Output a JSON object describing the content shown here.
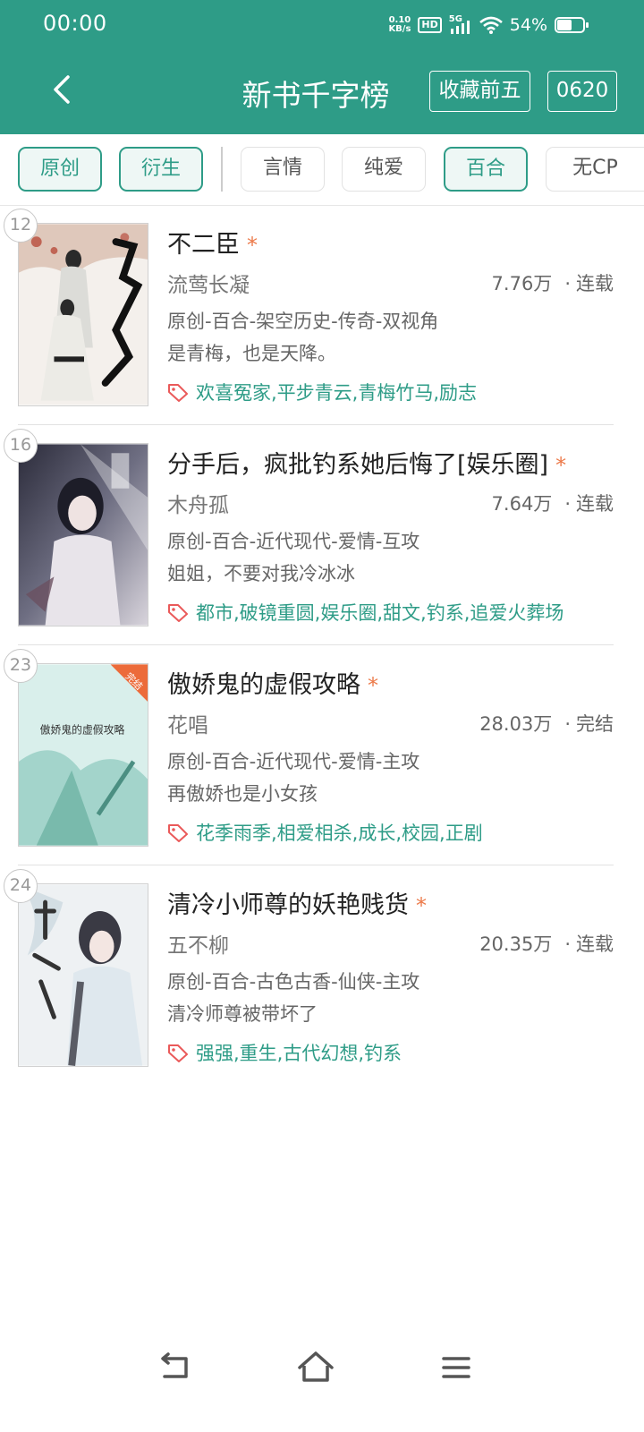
{
  "status_bar": {
    "time": "00:00",
    "net_speed_top": "0.10",
    "net_speed_unit": "KB/s",
    "hd": "HD",
    "network": "5G",
    "battery": "54%"
  },
  "header": {
    "title": "新书千字榜",
    "filter_button": "收藏前五",
    "date_button": "0620"
  },
  "chips": [
    "原创",
    "衍生",
    "言情",
    "纯爱",
    "百合",
    "无CP"
  ],
  "books": [
    {
      "rank": "12",
      "title": "不二臣",
      "star": "*",
      "author": "流莺长凝",
      "count": "7.76万",
      "status": "连载",
      "genre": "原创-百合-架空历史-传奇-双视角",
      "summary": "是青梅，也是天降。",
      "tags": "欢喜冤家,平步青云,青梅竹马,励志"
    },
    {
      "rank": "16",
      "title": "分手后，疯批钓系她后悔了[娱乐圈]",
      "star": "*",
      "author": "木舟孤",
      "count": "7.64万",
      "status": "连载",
      "genre": "原创-百合-近代现代-爱情-互攻",
      "summary": "姐姐，不要对我冷冰冰",
      "tags": "都市,破镜重圆,娱乐圈,甜文,钓系,追爱火葬场"
    },
    {
      "rank": "23",
      "title": "傲娇鬼的虚假攻略",
      "star": "*",
      "author": "花唱",
      "count": "28.03万",
      "status": "完结",
      "genre": "原创-百合-近代现代-爱情-主攻",
      "summary": "再傲娇也是小女孩",
      "tags": "花季雨季,相爱相杀,成长,校园,正剧",
      "cover_text": "傲娇鬼的虚假攻略",
      "cover_badge": "完结"
    },
    {
      "rank": "24",
      "title": "清冷小师尊的妖艳贱货",
      "star": "*",
      "author": "五不柳",
      "count": "20.35万",
      "status": "连载",
      "genre": "原创-百合-古色古香-仙侠-主攻",
      "summary": "清冷师尊被带坏了",
      "tags": "强强,重生,古代幻想,钓系"
    }
  ],
  "colors": {
    "primary": "#2e9c87",
    "star": "#ec7a4a"
  }
}
